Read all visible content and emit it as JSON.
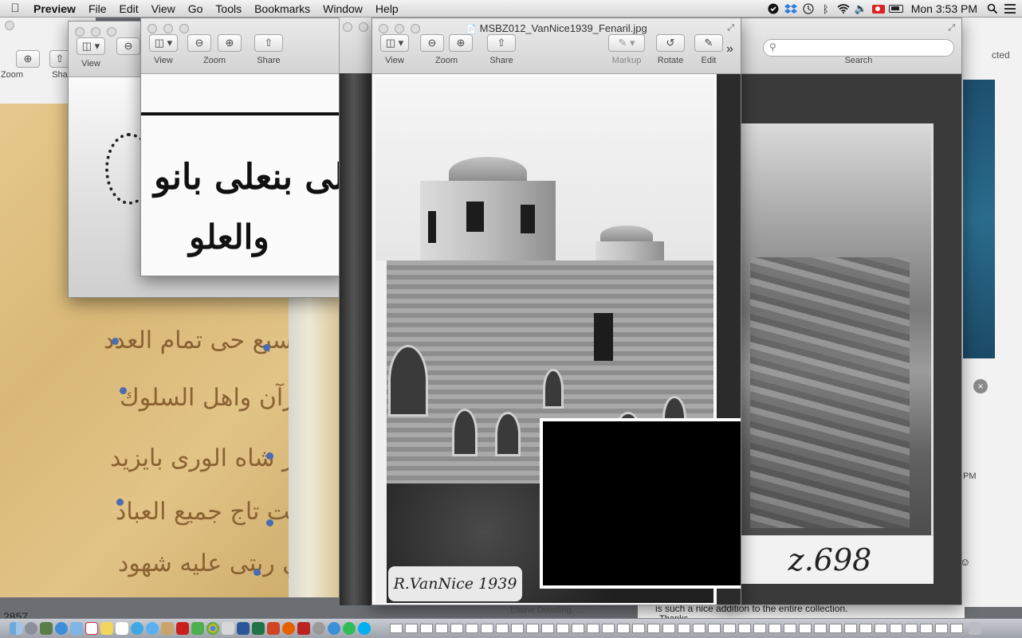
{
  "menubar": {
    "app_name": "Preview",
    "items": [
      "File",
      "Edit",
      "View",
      "Go",
      "Tools",
      "Bookmarks",
      "Window",
      "Help"
    ],
    "clock": "Mon 3:53 PM",
    "status_icons": [
      "evernote-icon",
      "dropbox-icon",
      "time-machine-icon",
      "bluetooth-icon",
      "wifi-icon",
      "volume-icon",
      "input-flag-icon",
      "battery-icon",
      "spotlight-icon",
      "notification-center-icon"
    ]
  },
  "toolbar": {
    "view": "View",
    "zoom": "Zoom",
    "share": "Share",
    "markup": "Markup",
    "rotate": "Rotate",
    "edit": "Edit",
    "search": "Search",
    "overflow": "»"
  },
  "front_window": {
    "title": "MSBZ012_VanNice1939_Fenaril.jpg",
    "photo_caption": "R.VanNice 1939"
  },
  "right_photo": {
    "caption": "z.698"
  },
  "manuscript": {
    "lines": [
      "وسبع حى تمام العدد",
      "وصاحب قيرآن واهل السلوك",
      "ابو النصر شاه الورى بايزيد",
      "بآدم وملكت تاج جميع العباد",
      "واملاكي ربتى عليه شهود"
    ]
  },
  "zoom_window": {
    "arabic_lines": [
      "قوالى بنعلى بانو",
      "والعلو"
    ]
  },
  "left_window": {
    "zoom_label": "Zoom",
    "share_label": "Sha"
  },
  "background_text": {
    "partial_word": "cted",
    "time_partial": "PM",
    "email_line_1": "is such a nice addition to the entire collection.",
    "email_line_2": "Thanks,",
    "sender_partial": "Elaine Dowding, ...",
    "counter": "2857"
  }
}
